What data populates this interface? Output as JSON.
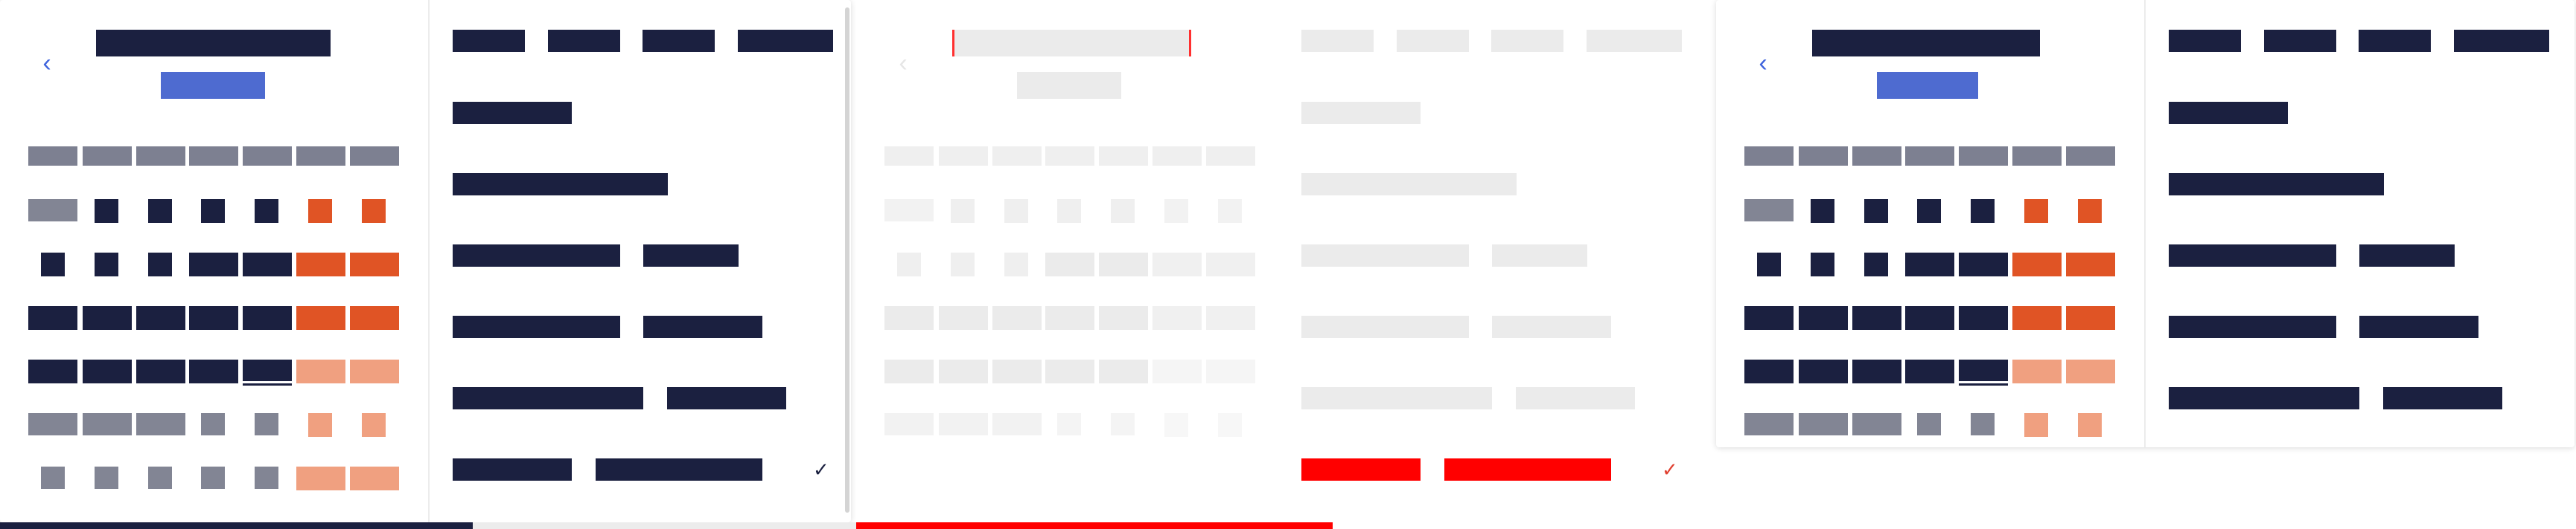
{
  "panels": [
    {
      "id": "date-picker-1",
      "state": "normal",
      "back_icon": "chevron-left-icon",
      "check_icon": "check-icon"
    },
    {
      "id": "date-picker-2",
      "state": "faded",
      "back_icon": "chevron-left-icon",
      "check_icon": "check-icon"
    },
    {
      "id": "date-picker-3",
      "state": "normal",
      "back_icon": "chevron-left-icon"
    }
  ],
  "glyphs": {
    "back": "‹",
    "check": "✓"
  },
  "colors": {
    "text_dark": "#1b2040",
    "accent_blue": "#4e6bd0",
    "weekend_orange": "#e05425",
    "weekend_light": "#f0a080",
    "muted_gray": "#828594",
    "highlight_red": "#ff0000"
  }
}
